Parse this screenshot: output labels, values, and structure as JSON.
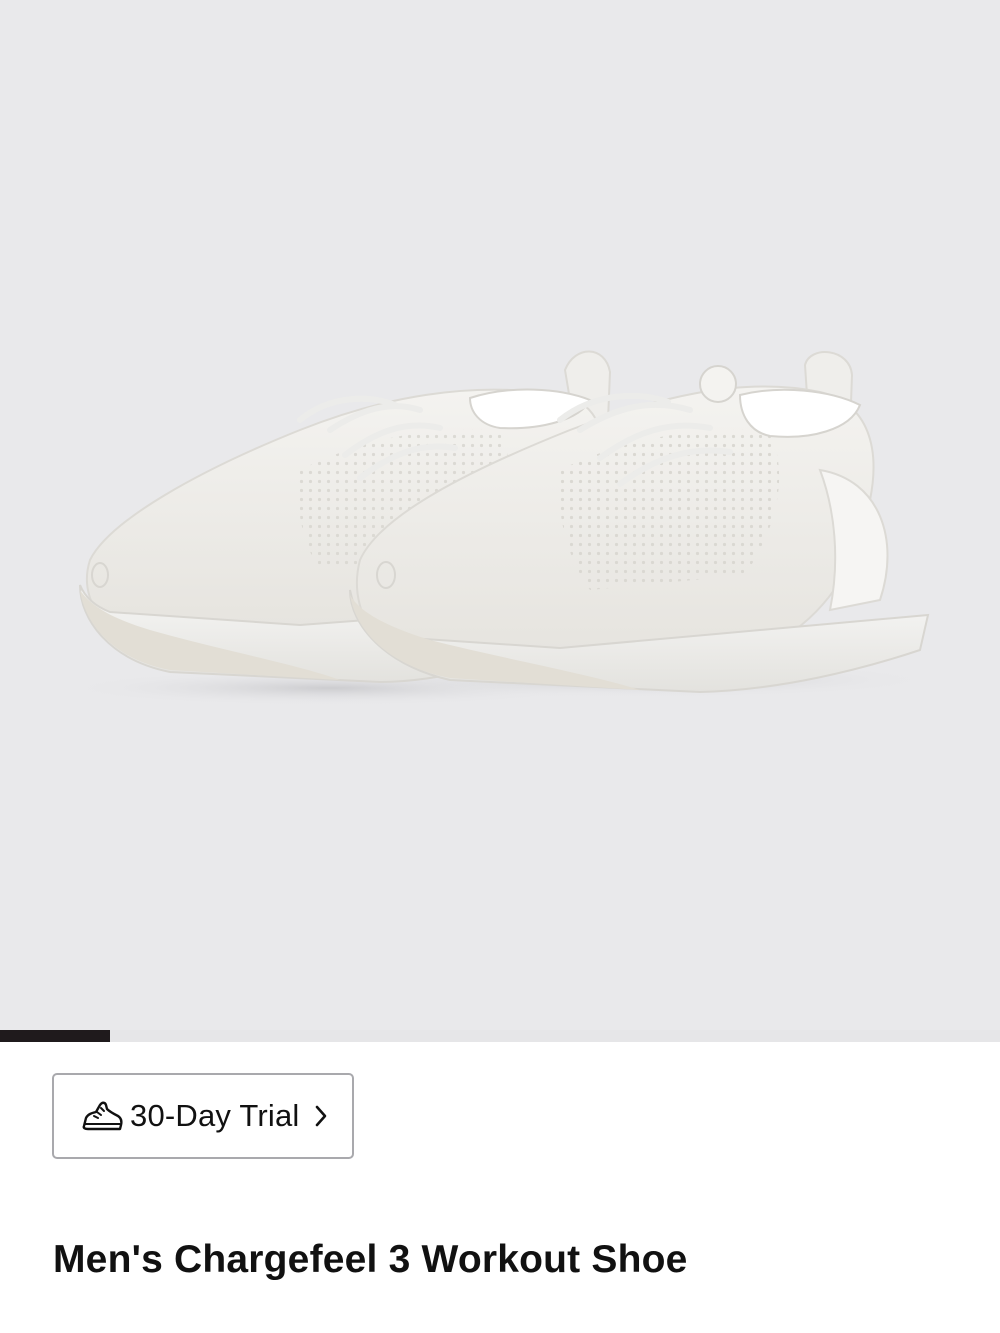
{
  "product": {
    "title": "Men's Chargefeel 3 Workout Shoe",
    "image_subject": "pair of white knit workout shoes",
    "image_background": "#e9e9eb"
  },
  "gallery": {
    "progress_fraction": 0.11,
    "track_color": "#e6e6e8",
    "fill_color": "#1f1a1c"
  },
  "trial": {
    "label": "30-Day Trial",
    "icon": "shoe-icon",
    "arrow_icon": "chevron-right-icon"
  }
}
